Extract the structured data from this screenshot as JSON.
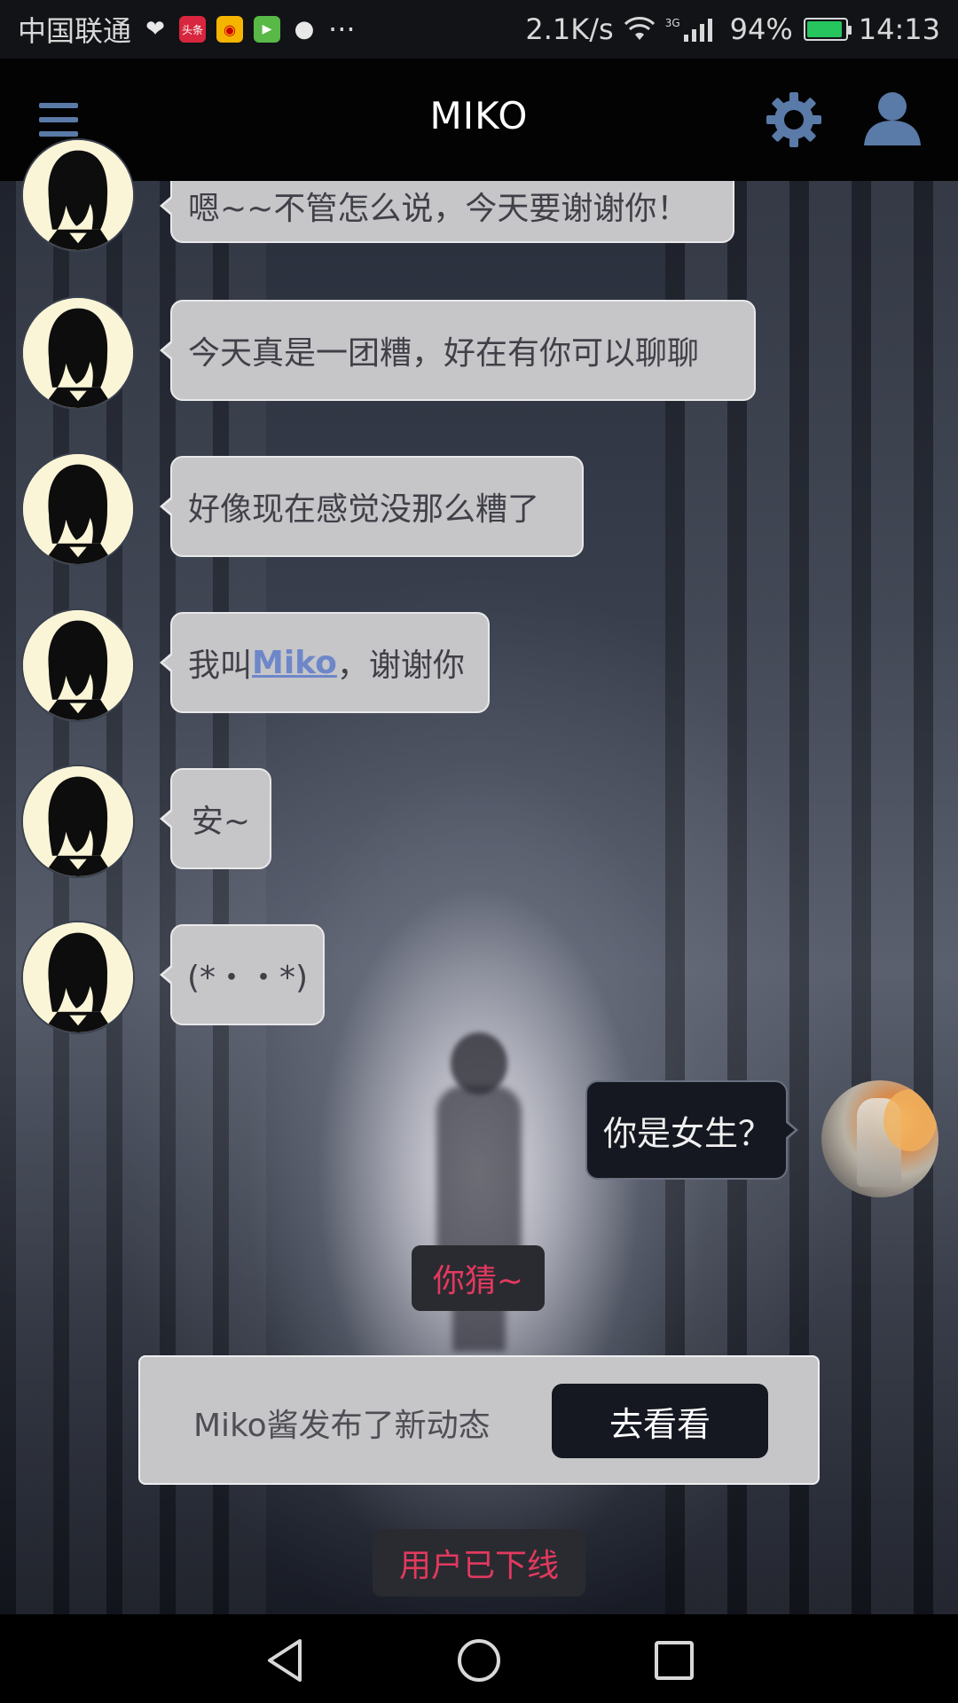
{
  "status_bar": {
    "carrier": "中国联通",
    "net_speed": "2.1K/s",
    "network_type": "3G",
    "battery_percent": "94%",
    "battery_level": 0.94,
    "time": "14:13",
    "more_dots": "···"
  },
  "header": {
    "title": "MIKO",
    "menu_icon": "hamburger-menu-icon",
    "settings_icon": "gear-icon",
    "profile_icon": "user-icon"
  },
  "messages": [
    {
      "sender": "miko",
      "text": "嗯~~不管怎么说，今天要谢谢你！"
    },
    {
      "sender": "miko",
      "text": "今天真是一团糟，好在有你可以聊聊"
    },
    {
      "sender": "miko",
      "text": "好像现在感觉没那么糟了"
    },
    {
      "sender": "miko",
      "text_before": "我叫",
      "link": "Miko",
      "text_after": "，谢谢你"
    },
    {
      "sender": "miko",
      "text": "安~"
    },
    {
      "sender": "miko",
      "text": "(*・・*)"
    },
    {
      "sender": "user",
      "text": "你是女生？"
    }
  ],
  "typing_hint": "你猜~",
  "notice": {
    "text": "Miko酱发布了新动态",
    "button_label": "去看看"
  },
  "offline_status": "用户已下线",
  "colors": {
    "accent_blue": "#5a7aa8",
    "link_blue": "#6d87c9",
    "alert_pink": "#e3395f",
    "battery_green": "#26c55d"
  },
  "nav_bar": {
    "back_icon": "back-triangle-icon",
    "home_icon": "home-circle-icon",
    "recent_icon": "recent-square-icon"
  }
}
